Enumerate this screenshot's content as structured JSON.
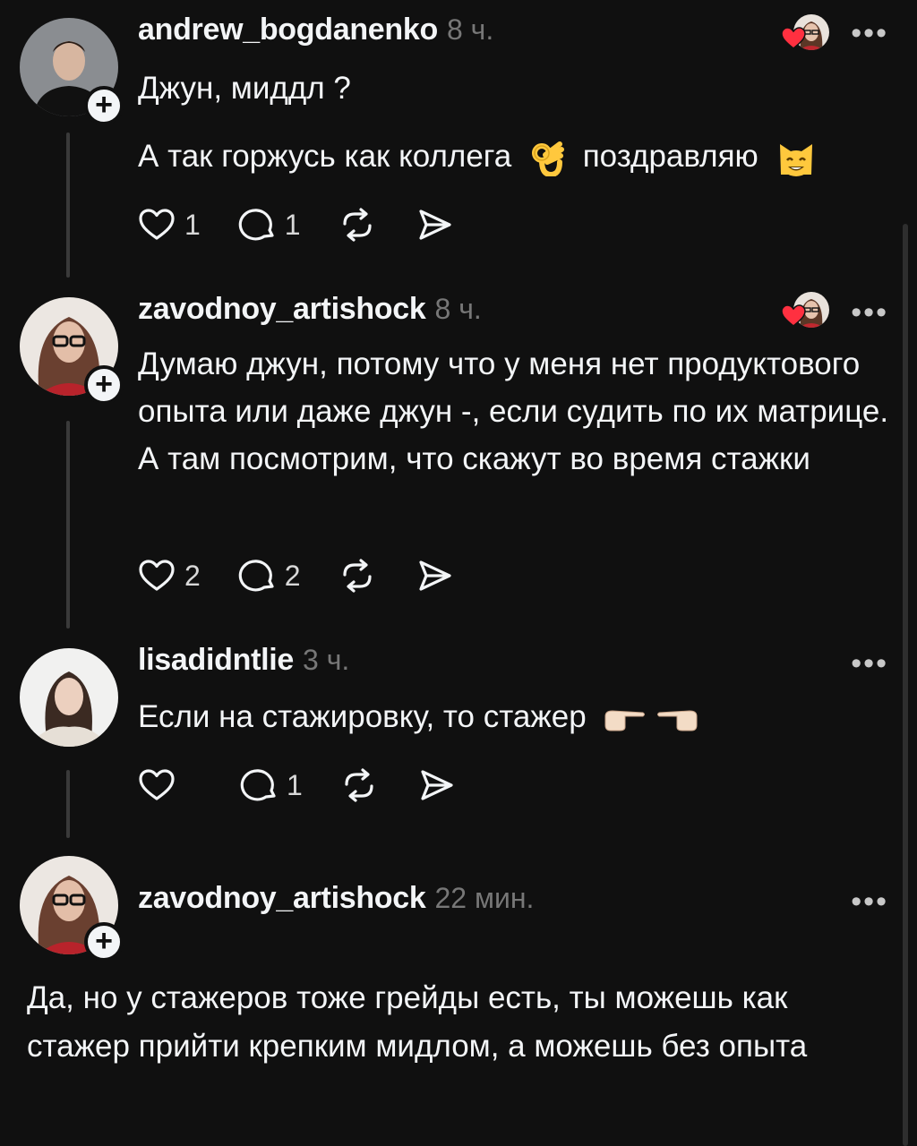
{
  "posts": [
    {
      "username": "andrew_bogdanenko",
      "time": "8 ч.",
      "lines": [
        "Джун, миддл ?",
        "А так горжусь как коллега",
        "поздравляю"
      ],
      "likes": "1",
      "replies": "1",
      "emoji": [
        "ok-hand-emoji",
        "smiling-cat-emoji"
      ],
      "liked_by_author": true
    },
    {
      "username": "zavodnoy_artishock",
      "time": "8 ч.",
      "text": "Думаю джун, потому что у меня нет продуктового опыта или даже джун -, если судить  по их матрице. А там посмотрим, что скажут во время стажки",
      "likes": "2",
      "replies": "2",
      "liked_by_author": true
    },
    {
      "username": "lisadidntlie",
      "time": "3 ч.",
      "text": "Если на стажировку, то стажер",
      "likes": "",
      "replies": "1",
      "emoji": [
        "pointing-right-emoji",
        "pointing-left-emoji"
      ],
      "liked_by_author": false
    },
    {
      "username": "zavodnoy_artishock",
      "time": "22 мин.",
      "text": "Да, но у стажеров тоже грейды есть, ты можешь как стажер прийти крепким мидлом, а можешь без опыта"
    }
  ],
  "ui": {
    "more": "•••",
    "follow_symbol": "+"
  },
  "colors": {
    "background": "#101010",
    "text": "#f3f5f7",
    "muted": "#777777",
    "heart": "#ff3040"
  }
}
